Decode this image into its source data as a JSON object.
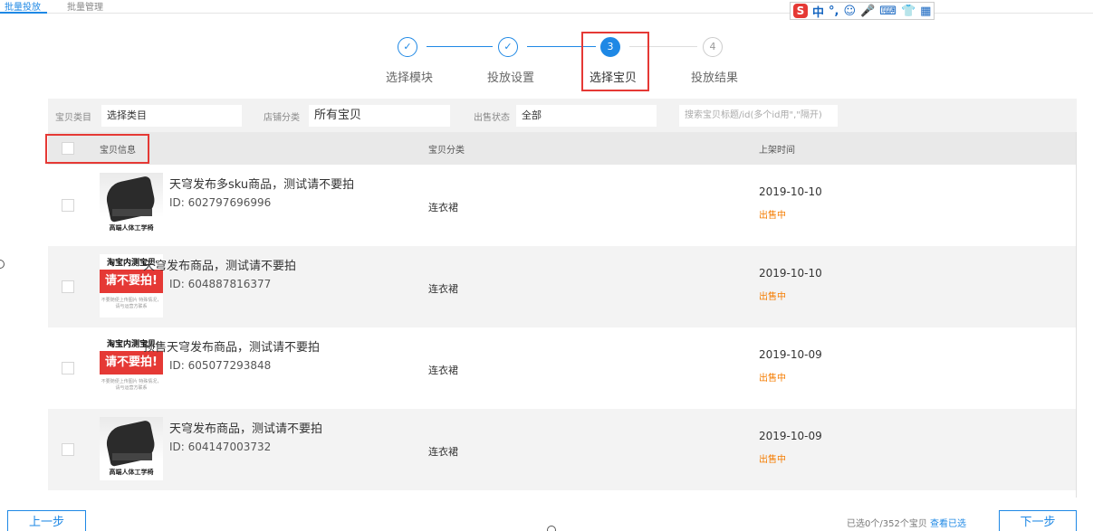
{
  "top_tabs": [
    {
      "label": "批量投放"
    },
    {
      "label": "批量管理"
    }
  ],
  "ime": {
    "brand": "S",
    "items": [
      "中",
      "°,",
      "☺",
      "🎤",
      "⌨",
      "👕",
      "▦"
    ]
  },
  "steps": [
    {
      "number": "✓",
      "label": "选择模块"
    },
    {
      "number": "✓",
      "label": "投放设置"
    },
    {
      "number": "3",
      "label": "选择宝贝"
    },
    {
      "number": "4",
      "label": "投放结果"
    }
  ],
  "filters": {
    "category_label": "宝贝类目",
    "category_value": "选择类目",
    "shop_category_label": "店铺分类",
    "shop_category_value": "所有宝贝",
    "sale_status_label": "出售状态",
    "sale_status_value": "全部",
    "search_placeholder": "搜索宝贝标题/id(多个id用\",\"隔开)"
  },
  "table": {
    "headers": {
      "info": "宝贝信息",
      "category": "宝贝分类",
      "listed": "上架时间"
    },
    "rows": [
      {
        "title": "天穹发布多sku商品，测试请不要拍",
        "id": "ID: 602797696996",
        "category": "连衣裙",
        "date": "2019-10-10",
        "status": "出售中",
        "thumb": "photo"
      },
      {
        "title": "天穹发布商品，测试请不要拍",
        "id": "ID: 604887816377",
        "category": "连衣裙",
        "date": "2019-10-10",
        "status": "出售中",
        "thumb": "text"
      },
      {
        "title": "预售天穹发布商品，测试请不要拍",
        "id": "ID: 605077293848",
        "category": "连衣裙",
        "date": "2019-10-09",
        "status": "出售中",
        "thumb": "text"
      },
      {
        "title": "天穹发布商品，测试请不要拍",
        "id": "ID: 604147003732",
        "category": "连衣裙",
        "date": "2019-10-09",
        "status": "出售中",
        "thumb": "photo"
      }
    ]
  },
  "thumbs": {
    "photo_caption": "高端人体工学椅",
    "text_line1": "淘宝内测宝贝",
    "text_line2": "请不要拍!",
    "text_line3": "不要随便上传图片 特殊情况，请与运营方联系"
  },
  "footer": {
    "prev": "上一步",
    "next": "下一步",
    "selected_info": "已选0个/352个宝贝",
    "view_selected": "查看已选"
  },
  "colors": {
    "accent": "#1e88e5",
    "highlight_box": "#e53935",
    "status": "#f57c00"
  }
}
